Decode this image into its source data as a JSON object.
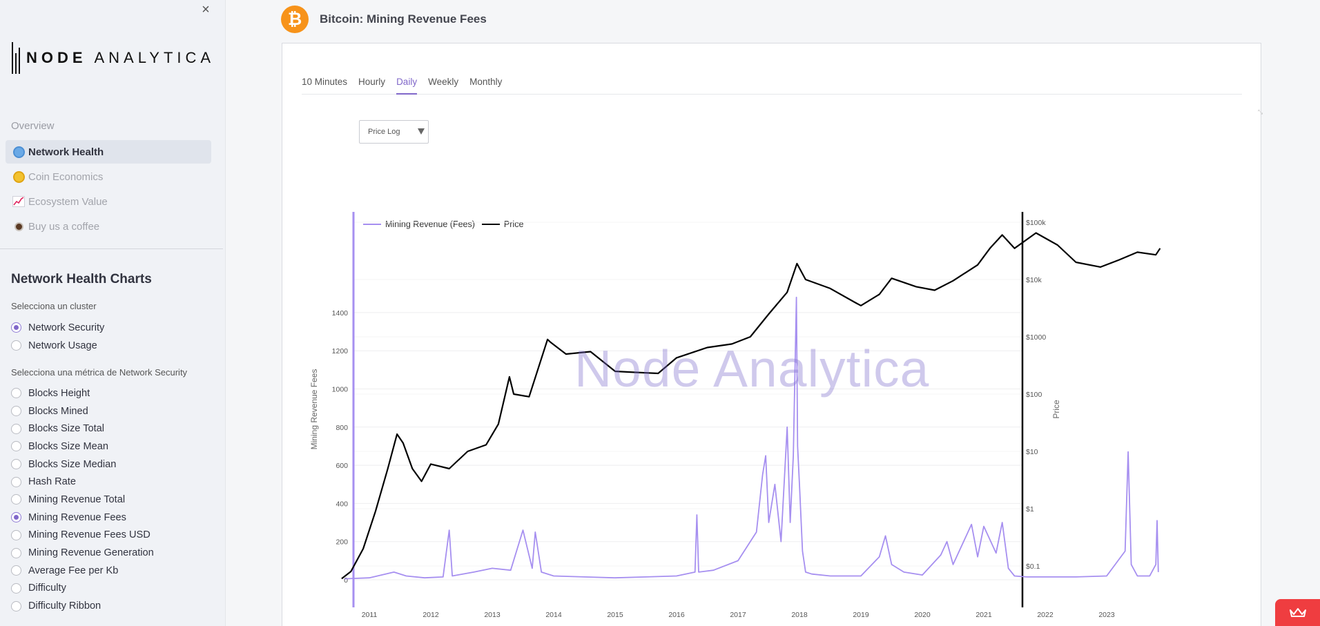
{
  "sidebar": {
    "close_icon": "×",
    "logo": {
      "bold": "NODE",
      "light": "ANALYTICA"
    },
    "overview_label": "Overview",
    "nav": [
      {
        "label": "Network Health",
        "icon": "globe-icon",
        "active": true
      },
      {
        "label": "Coin Economics",
        "icon": "coin-icon",
        "active": false
      },
      {
        "label": "Ecosystem Value",
        "icon": "chart-increasing-icon",
        "active": false
      },
      {
        "label": "Buy us a coffee",
        "icon": "coffee-icon",
        "active": false
      }
    ],
    "charts_title": "Network Health Charts",
    "cluster_label": "Selecciona un cluster",
    "clusters": [
      {
        "label": "Network Security",
        "checked": true
      },
      {
        "label": "Network Usage",
        "checked": false
      }
    ],
    "metric_label": "Selecciona una métrica de Network Security",
    "metrics": [
      {
        "label": "Blocks Height",
        "checked": false
      },
      {
        "label": "Blocks Mined",
        "checked": false
      },
      {
        "label": "Blocks Size Total",
        "checked": false
      },
      {
        "label": "Blocks Size Mean",
        "checked": false
      },
      {
        "label": "Blocks Size Median",
        "checked": false
      },
      {
        "label": "Hash Rate",
        "checked": false
      },
      {
        "label": "Mining Revenue Total",
        "checked": false
      },
      {
        "label": "Mining Revenue Fees",
        "checked": true
      },
      {
        "label": "Mining Revenue Fees USD",
        "checked": false
      },
      {
        "label": "Mining Revenue Generation",
        "checked": false
      },
      {
        "label": "Average Fee per Kb",
        "checked": false
      },
      {
        "label": "Difficulty",
        "checked": false
      },
      {
        "label": "Difficulty Ribbon",
        "checked": false
      }
    ]
  },
  "header": {
    "coin_symbol": "₿",
    "title": "Bitcoin: Mining Revenue Fees"
  },
  "tabs": [
    {
      "label": "10 Minutes",
      "active": false
    },
    {
      "label": "Hourly",
      "active": false
    },
    {
      "label": "Daily",
      "active": true
    },
    {
      "label": "Weekly",
      "active": false
    },
    {
      "label": "Monthly",
      "active": false
    }
  ],
  "scale_select": {
    "value": "Price Log"
  },
  "watermark": "Node Analytica",
  "colors": {
    "accent": "#8067c9",
    "fees_series": "#a68ff0",
    "price_series": "#000000",
    "coin": "#f7931a",
    "float_button": "#ef3d40"
  },
  "chart_data": {
    "type": "line",
    "xlabel": "",
    "ylabel": "Mining Revenue Fees",
    "y2label": "Price",
    "x_ticks": [
      "2011",
      "2012",
      "2013",
      "2014",
      "2015",
      "2016",
      "2017",
      "2018",
      "2019",
      "2020",
      "2021",
      "2022",
      "2023"
    ],
    "y_ticks": [
      0,
      200,
      400,
      600,
      800,
      1000,
      1200,
      1400
    ],
    "y2_ticks": [
      "$0.1",
      "$1",
      "$10",
      "$100",
      "$1000",
      "$10k",
      "$100k"
    ],
    "ylim": [
      -105,
      1560
    ],
    "y2_scale": "log",
    "legend": "top-left",
    "series": [
      {
        "name": "Mining Revenue (Fees)",
        "axis": "left",
        "x": [
          2010.6,
          2011.0,
          2011.4,
          2011.6,
          2011.9,
          2012.2,
          2012.3,
          2012.35,
          2012.7,
          2013.0,
          2013.3,
          2013.5,
          2013.65,
          2013.7,
          2013.8,
          2014.0,
          2014.5,
          2015.0,
          2015.5,
          2016.0,
          2016.3,
          2016.33,
          2016.36,
          2016.6,
          2017.0,
          2017.3,
          2017.4,
          2017.45,
          2017.5,
          2017.6,
          2017.7,
          2017.8,
          2017.85,
          2017.9,
          2017.95,
          2017.97,
          2018.0,
          2018.05,
          2018.1,
          2018.2,
          2018.5,
          2019.0,
          2019.3,
          2019.4,
          2019.5,
          2019.7,
          2020.0,
          2020.3,
          2020.4,
          2020.5,
          2020.6,
          2020.8,
          2020.9,
          2021.0,
          2021.2,
          2021.3,
          2021.4,
          2021.5,
          2021.7,
          2022.0,
          2022.5,
          2023.0,
          2023.3,
          2023.35,
          2023.4,
          2023.5,
          2023.7,
          2023.8,
          2023.82,
          2023.84
        ],
        "values": [
          5,
          10,
          40,
          20,
          10,
          15,
          260,
          20,
          40,
          60,
          50,
          260,
          60,
          250,
          40,
          20,
          15,
          10,
          15,
          20,
          40,
          340,
          40,
          50,
          100,
          250,
          550,
          650,
          300,
          500,
          200,
          800,
          300,
          650,
          1480,
          700,
          500,
          150,
          40,
          30,
          20,
          20,
          120,
          230,
          80,
          40,
          25,
          130,
          200,
          80,
          150,
          290,
          120,
          280,
          140,
          300,
          60,
          20,
          15,
          15,
          15,
          20,
          150,
          670,
          80,
          20,
          20,
          80,
          310,
          40
        ]
      },
      {
        "name": "Price",
        "axis": "right",
        "x": [
          2010.55,
          2010.7,
          2010.9,
          2011.1,
          2011.3,
          2011.45,
          2011.55,
          2011.7,
          2011.85,
          2012.0,
          2012.3,
          2012.6,
          2012.9,
          2013.1,
          2013.28,
          2013.35,
          2013.6,
          2013.9,
          2013.95,
          2014.2,
          2014.6,
          2015.0,
          2015.3,
          2015.7,
          2016.0,
          2016.5,
          2016.9,
          2017.2,
          2017.5,
          2017.8,
          2017.96,
          2018.1,
          2018.5,
          2018.9,
          2019.0,
          2019.3,
          2019.5,
          2019.9,
          2020.2,
          2020.5,
          2020.9,
          2021.1,
          2021.3,
          2021.5,
          2021.85,
          2022.2,
          2022.5,
          2022.9,
          2023.2,
          2023.5,
          2023.8,
          2023.87
        ],
        "values": [
          0.06,
          0.08,
          0.2,
          0.9,
          5,
          20,
          14,
          5,
          3,
          6,
          5,
          10,
          13,
          30,
          200,
          100,
          90,
          900,
          800,
          500,
          550,
          250,
          240,
          230,
          430,
          650,
          750,
          1000,
          2500,
          6000,
          19000,
          10000,
          7000,
          4000,
          3500,
          5500,
          10500,
          7500,
          6500,
          9500,
          18000,
          35000,
          60000,
          35000,
          65000,
          40000,
          20000,
          16500,
          22000,
          30000,
          27000,
          35000
        ]
      }
    ]
  },
  "float_button": {
    "icon": "crown-icon"
  }
}
